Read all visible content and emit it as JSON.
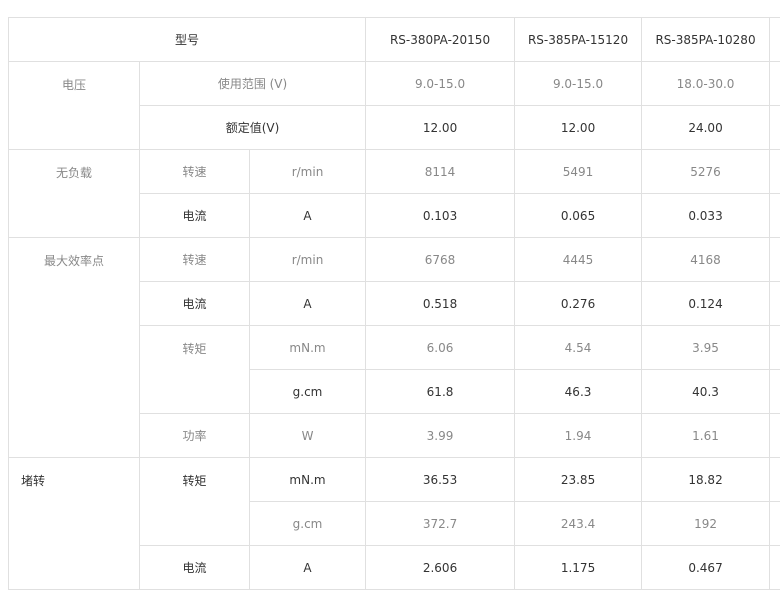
{
  "header": {
    "model_label": "型号",
    "models": [
      "RS-380PA-20150",
      "RS-385PA-15120",
      "RS-385PA-10280"
    ]
  },
  "voltage": {
    "label": "电压",
    "range_label": "使用范围 (V)",
    "range_values": [
      "9.0-15.0",
      "9.0-15.0",
      "18.0-30.0"
    ],
    "rated_label": "额定值(V)",
    "rated_values": [
      "12.00",
      "12.00",
      "24.00"
    ]
  },
  "no_load": {
    "label": "无负载",
    "speed_label": "转速",
    "speed_unit": "r/min",
    "speed_values": [
      "8114",
      "5491",
      "5276"
    ],
    "current_label": "电流",
    "current_unit": "A",
    "current_values": [
      "0.103",
      "0.065",
      "0.033"
    ]
  },
  "max_efficiency": {
    "label": "最大效率点",
    "speed_label": "转速",
    "speed_unit": "r/min",
    "speed_values": [
      "6768",
      "4445",
      "4168"
    ],
    "current_label": "电流",
    "current_unit": "A",
    "current_values": [
      "0.518",
      "0.276",
      "0.124"
    ],
    "torque_label": "转矩",
    "torque_unit_mnm": "mN.m",
    "torque_mnm_values": [
      "6.06",
      "4.54",
      "3.95"
    ],
    "torque_unit_gcm": "g.cm",
    "torque_gcm_values": [
      "61.8",
      "46.3",
      "40.3"
    ],
    "power_label": "功率",
    "power_unit": "W",
    "power_values": [
      "3.99",
      "1.94",
      "1.61"
    ]
  },
  "stall": {
    "label": "堵转",
    "torque_label": "转矩",
    "torque_unit_mnm": "mN.m",
    "torque_mnm_values": [
      "36.53",
      "23.85",
      "18.82"
    ],
    "torque_unit_gcm": "g.cm",
    "torque_gcm_values": [
      "372.7",
      "243.4",
      "192"
    ],
    "current_label": "电流",
    "current_unit": "A",
    "current_values": [
      "2.606",
      "1.175",
      "0.467"
    ]
  }
}
